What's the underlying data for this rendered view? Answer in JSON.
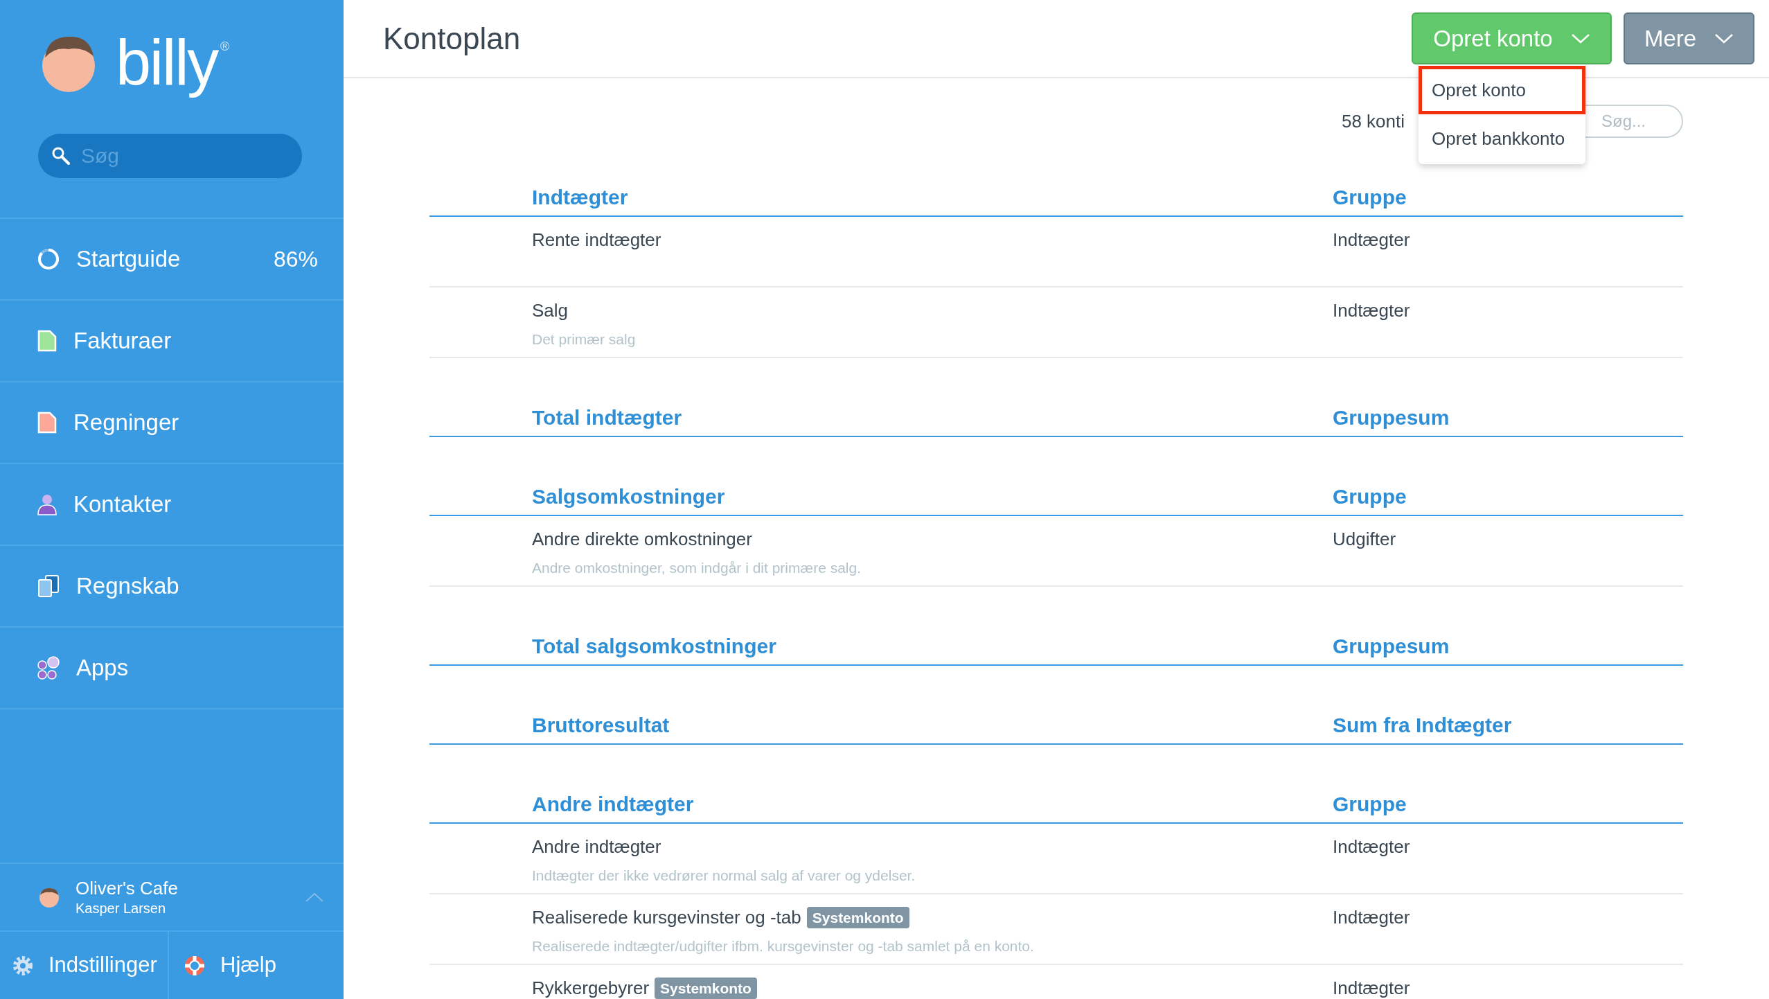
{
  "sidebar": {
    "logo": {
      "text": "billy",
      "mark": "®"
    },
    "search": {
      "placeholder": "Søg"
    },
    "items": [
      {
        "kind": "progress",
        "label": "Startguide",
        "value": "86%",
        "level": 0.86
      },
      {
        "kind": "invoices",
        "label": "Fakturaer"
      },
      {
        "kind": "bills",
        "label": "Regninger"
      },
      {
        "kind": "contacts",
        "label": "Kontakter"
      },
      {
        "kind": "accounting",
        "label": "Regnskab"
      },
      {
        "kind": "apps",
        "label": "Apps"
      }
    ],
    "account": {
      "company": "Oliver's Cafe",
      "user": "Kasper Larsen"
    },
    "footer": [
      {
        "kind": "settings",
        "label": "Indstillinger"
      },
      {
        "kind": "help",
        "label": "Hjælp"
      }
    ]
  },
  "header": {
    "title": "Kontoplan",
    "buttons": [
      {
        "kind": "primary",
        "label": "Opret konto"
      },
      {
        "kind": "secondary",
        "label": "Mere"
      }
    ],
    "dropdown": [
      {
        "label": "Opret konto",
        "selected": true
      },
      {
        "label": "Opret bankkonto",
        "selected": false
      }
    ]
  },
  "toolbar": {
    "count": "58 konti",
    "search": {
      "placeholder": "Søg..."
    }
  },
  "rows": [
    {
      "kind": "heading",
      "name": "Indtægter",
      "group": "Gruppe"
    },
    {
      "kind": "account",
      "name": "Rente indtægter",
      "group": "Indtægter"
    },
    {
      "kind": "account",
      "name": "Salg",
      "description": "Det primær salg",
      "group": "Indtægter"
    },
    {
      "kind": "heading",
      "name": "Total indtægter",
      "group": "Gruppesum"
    },
    {
      "kind": "heading",
      "name": "Salgsomkostninger",
      "group": "Gruppe"
    },
    {
      "kind": "account",
      "name": "Andre direkte omkostninger",
      "description": "Andre omkostninger, som indgår i dit primære salg.",
      "group": "Udgifter"
    },
    {
      "kind": "heading",
      "name": "Total salgsomkostninger",
      "group": "Gruppesum"
    },
    {
      "kind": "heading",
      "name": "Bruttoresultat",
      "group": "Sum fra Indtægter"
    },
    {
      "kind": "heading",
      "name": "Andre indtægter",
      "group": "Gruppe"
    },
    {
      "kind": "account",
      "name": "Andre indtægter",
      "description": "Indtægter der ikke vedrører normal salg af varer og ydelser.",
      "group": "Indtægter"
    },
    {
      "kind": "account",
      "name": "Realiserede kursgevinster og -tab",
      "badge": "Systemkonto",
      "description": "Realiserede indtægter/udgifter ifbm. kursgevinster og -tab samlet på en konto.",
      "group": "Indtægter"
    },
    {
      "kind": "account",
      "name": "Rykkergebyrer",
      "badge": "Systemkonto",
      "group": "Indtægter"
    }
  ]
}
